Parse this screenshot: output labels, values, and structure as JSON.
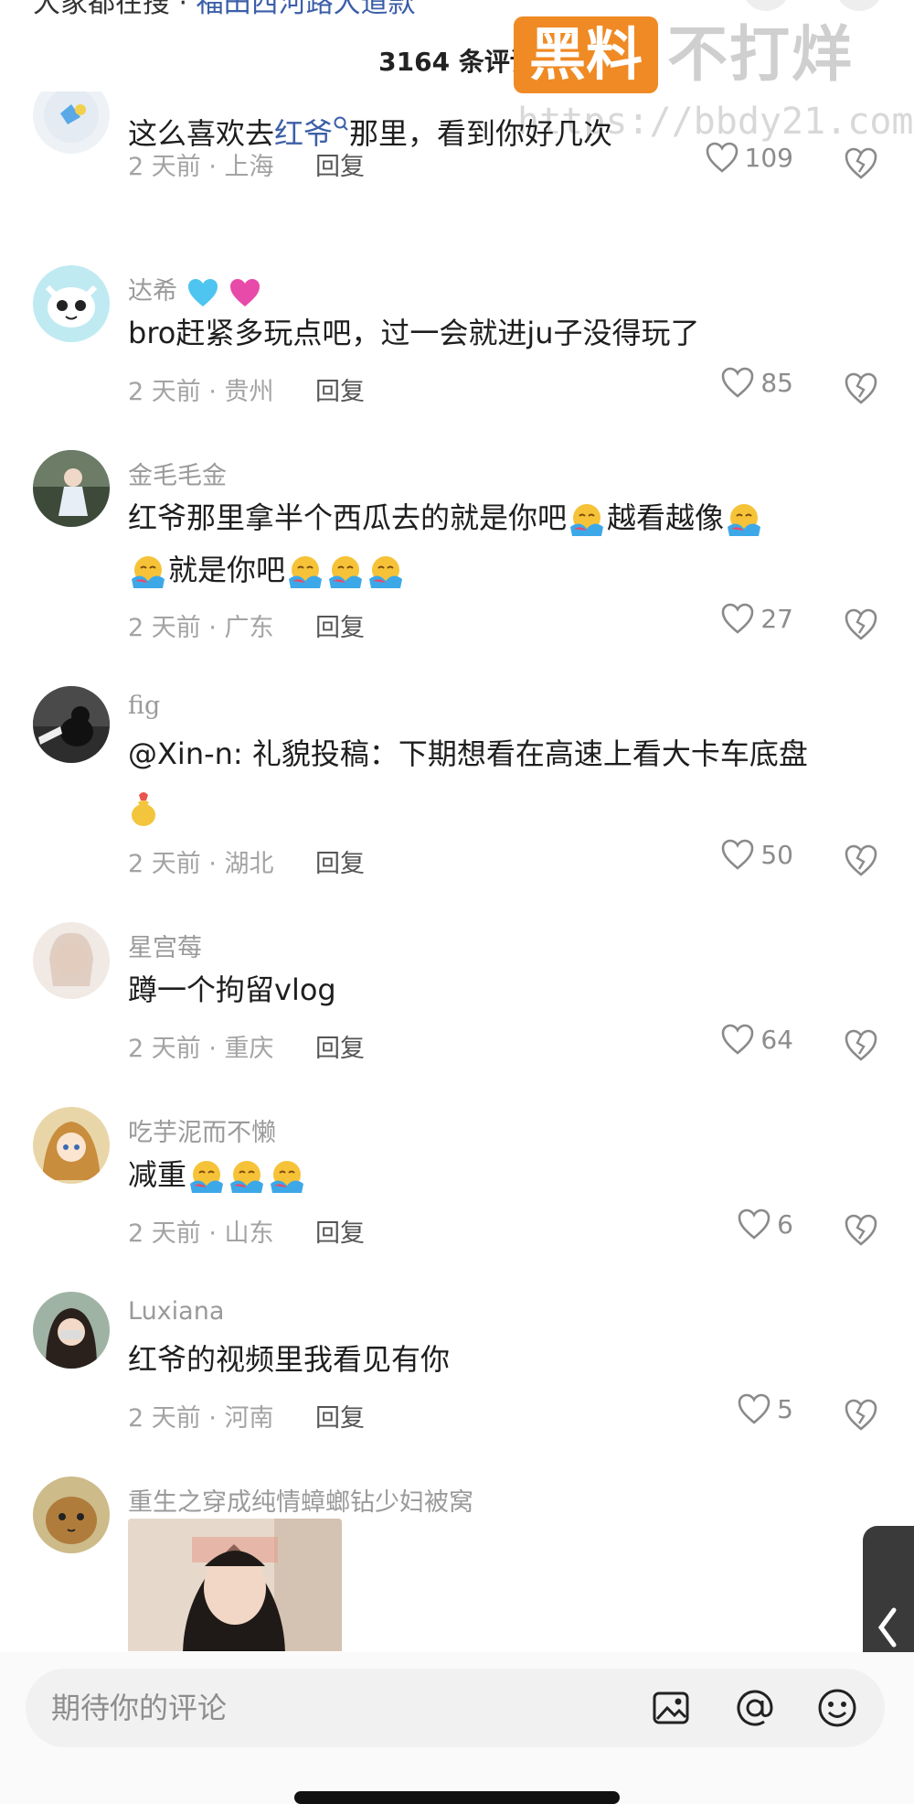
{
  "top_strip": {
    "search_prefix": "大家都在搜 ·",
    "search_link": "福田西河路大道款"
  },
  "header": {
    "title": "3164 条评论"
  },
  "watermark": {
    "box_text": "黑料",
    "big_text": "不打烊",
    "url": "https://bbdy21.com"
  },
  "comments": [
    {
      "username": "",
      "text_before": "这么喜欢去",
      "mention": "红爷",
      "text_after": "那里，看到你好几次",
      "meta": "2 天前 · 上海",
      "reply": "回复",
      "likes": "109"
    },
    {
      "username": "达希",
      "text": "bro赶紧多玩点吧，过一会就进ju子没得玩了",
      "meta": "2 天前 · 贵州",
      "reply": "回复",
      "likes": "85"
    },
    {
      "username": "金毛毛金",
      "line1": "红爷那里拿半个西瓜去的就是你吧",
      "line1b": "越看越像",
      "line2": "就是你吧",
      "meta": "2 天前 · 广东",
      "reply": "回复",
      "likes": "27"
    },
    {
      "username": "fig",
      "text": "@Xin-n: 礼貌投稿：下期想看在高速上看大卡车底盘",
      "meta": "2 天前 · 湖北",
      "reply": "回复",
      "likes": "50"
    },
    {
      "username": "星宫莓",
      "text": "蹲一个拘留vlog",
      "meta": "2 天前 · 重庆",
      "reply": "回复",
      "likes": "64"
    },
    {
      "username": "吃芋泥而不懒",
      "text": "减重",
      "meta": "2 天前 · 山东",
      "reply": "回复",
      "likes": "6"
    },
    {
      "username": "Luxiana",
      "text": "红爷的视频里我看见有你",
      "meta": "2 天前 · 河南",
      "reply": "回复",
      "likes": "5"
    },
    {
      "username": "重生之穿成纯情蟑螂钻少妇被窝"
    }
  ],
  "input": {
    "placeholder": "期待你的评论"
  },
  "icons": [
    "search-icon",
    "image-icon",
    "at-icon",
    "emoji-icon",
    "heart-icon",
    "broken-heart-icon",
    "chevron-left-icon"
  ],
  "colors": {
    "accent_link": "#3d5fa8",
    "watermark_orange": "#f08a24",
    "meta_gray": "#a3a3a3"
  }
}
